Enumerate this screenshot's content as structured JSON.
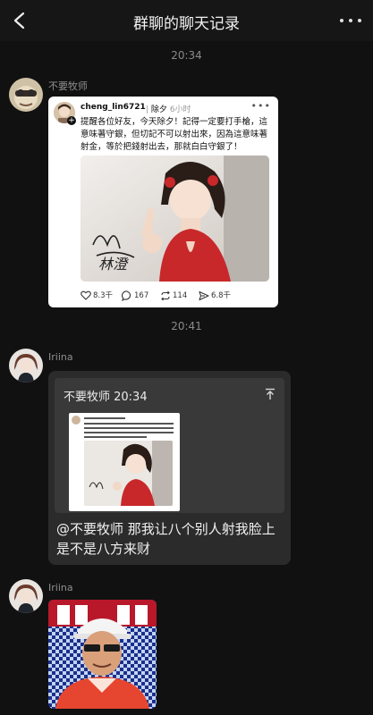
{
  "header": {
    "title": "群聊的聊天记录"
  },
  "timestamps": [
    "20:34",
    "20:41"
  ],
  "messages": [
    {
      "sender": "不要牧师",
      "post": {
        "username": "cheng_lin6721",
        "separator": "|",
        "topic": "除夕",
        "ago": "6小时",
        "text": "提醒各位好友，今天除夕！記得一定要打手槍，這意味著守銀，但切記不可以射出來，因為這意味著射金，等於把錢射出去，那就白白守銀了！",
        "signature": "林澄",
        "stats": {
          "likes": "8.3千",
          "comments": "167",
          "reposts": "114",
          "shares": "6.8千"
        }
      }
    },
    {
      "sender": "Iriina",
      "quote": {
        "header": "不要牧师 20:34"
      },
      "text": "@不要牧师 那我让八个别人射我脸上是不是八方来财"
    },
    {
      "sender": "Iriina",
      "image": "photo"
    }
  ],
  "colors": {
    "background": "#111111",
    "bubble": "#2b2b2b",
    "quote": "#393939"
  },
  "icons": [
    "back-arrow-icon",
    "more-icon",
    "plus-icon",
    "heart-icon",
    "comment-icon",
    "repost-icon",
    "share-icon",
    "pin-top-icon"
  ]
}
